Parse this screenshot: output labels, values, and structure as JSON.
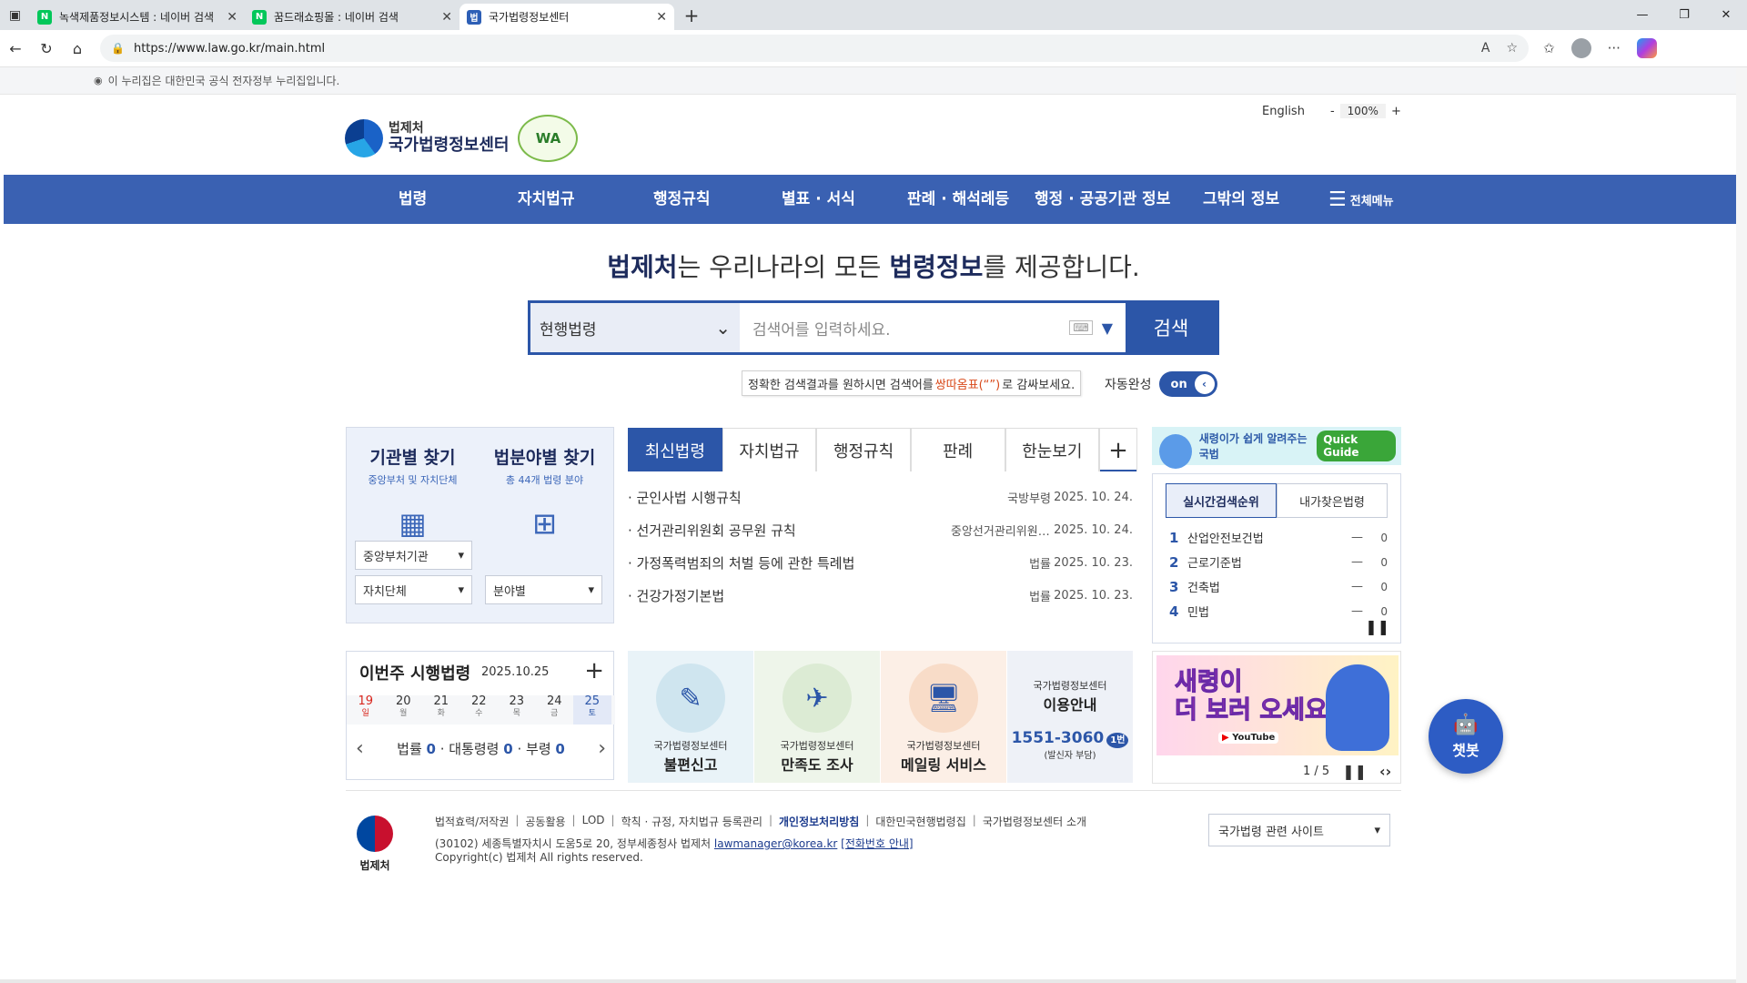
{
  "browser": {
    "tabs": [
      {
        "title": "녹색제품정보시스템 : 네이버 검색",
        "favicon": "N"
      },
      {
        "title": "꿈드래쇼핑몰 : 네이버 검색",
        "favicon": "N"
      },
      {
        "title": "국가법령정보센터",
        "favicon": "법"
      }
    ],
    "url": "https://www.law.go.kr/main.html"
  },
  "govbar": {
    "text": "이 누리집은 대한민국 공식 전자정부 누리집입니다."
  },
  "header": {
    "logo_small": "법제처",
    "logo_big": "국가법령정보센터",
    "wa_mark": "WA",
    "english": "English",
    "zoom_minus": "-",
    "zoom_value": "100%",
    "zoom_plus": "+"
  },
  "gnb": {
    "items": [
      "법령",
      "자치법규",
      "행정규칙",
      "별표 · 서식",
      "판례 · 해석례등",
      "행정 · 공공기관 정보",
      "그밖의 정보"
    ],
    "all_menu": "전체메뉴"
  },
  "slogan": {
    "b1": "법제처",
    "t1": "는 우리나라의 모든 ",
    "b2": "법령정보",
    "t2": "를 제공합니다."
  },
  "search": {
    "scope": "현행법령",
    "placeholder": "검색어를 입력하세요.",
    "button": "검색",
    "tip_pre": "정확한 검색결과를 원하시면 검색어를 ",
    "tip_em": "쌍따옴표(“”)",
    "tip_post": "로 감싸보세요.",
    "auto_label": "자동완성",
    "auto_state": "on"
  },
  "find": {
    "org_title": "기관별 찾기",
    "org_sub": "중앙부처 및 자치단체",
    "field_title": "법분야별 찾기",
    "field_sub": "총 44개 법령 분야",
    "sel_central": "중앙부처기관",
    "sel_local": "자치단체",
    "sel_field": "분야별"
  },
  "news": {
    "tabs": [
      "최신법령",
      "자치법규",
      "행정규칙",
      "판례",
      "한눈보기"
    ],
    "plus": "+",
    "rows": [
      {
        "title": "· 군인사법 시행규칙",
        "src": "국방부령",
        "date": "2025. 10. 24."
      },
      {
        "title": "· 선거관리위원회 공무원 규칙",
        "src": "중앙선거관리위원회규칙",
        "date": "2025. 10. 24."
      },
      {
        "title": "· 가정폭력범죄의 처벌 등에 관한 특례법",
        "src": "법률",
        "date": "2025. 10. 23."
      },
      {
        "title": "· 건강가정기본법",
        "src": "법률",
        "date": "2025. 10. 23."
      }
    ]
  },
  "quickguide": {
    "text": "새령이가 쉽게 알려주는 국법",
    "badge": "Quick Guide"
  },
  "rank": {
    "tab_realtime": "실시간검색순위",
    "tab_mine": "내가찾은법령",
    "rows": [
      {
        "n": "1",
        "t": "산업안전보건법",
        "v": "0"
      },
      {
        "n": "2",
        "t": "근로기준법",
        "v": "0"
      },
      {
        "n": "3",
        "t": "건축법",
        "v": "0"
      },
      {
        "n": "4",
        "t": "민법",
        "v": "0"
      }
    ]
  },
  "weekly": {
    "title": "이번주 시행법령",
    "date": "2025.10.25",
    "plus": "+",
    "days": [
      {
        "d": "19",
        "w": "일"
      },
      {
        "d": "20",
        "w": "월"
      },
      {
        "d": "21",
        "w": "화"
      },
      {
        "d": "22",
        "w": "수"
      },
      {
        "d": "23",
        "w": "목"
      },
      {
        "d": "24",
        "w": "금"
      },
      {
        "d": "25",
        "w": "토"
      }
    ],
    "law_label": "법률",
    "law_count": "0",
    "decree_label": "대통령령",
    "decree_count": "0",
    "ord_label": "부령",
    "ord_count": "0"
  },
  "banners": [
    {
      "sub": "국가법령정보센터",
      "title": "불편신고"
    },
    {
      "sub": "국가법령정보센터",
      "title": "만족도 조사"
    },
    {
      "sub": "국가법령정보센터",
      "title": "메일링 서비스"
    }
  ],
  "guide_banner": {
    "sub": "국가법령정보센터",
    "title": "이용안내",
    "phone": "1551-3060",
    "ext": "1번",
    "note": "(발신자 부담)"
  },
  "promo": {
    "line1": "새령이",
    "line2": "더 보러 오세요!",
    "yt": "YouTube",
    "page": "1 / 5"
  },
  "chatbot": {
    "label": "챗봇"
  },
  "footer": {
    "logo": "법제처",
    "links": [
      "법적효력/저작권",
      "공동활용",
      "LOD",
      "학칙 · 규정, 자치법규 등록관리",
      "개인정보처리방침",
      "대한민국현행법령집",
      "국가법령정보센터 소개"
    ],
    "addr": "(30102) 세종특별자치시 도움5로 20, 정부세종청사 법제처",
    "email": "lawmanager@korea.kr",
    "phone_info": "[전화번호 안내]",
    "copyright": "Copyright(c) 법제처 All rights reserved.",
    "related": "국가법령 관련 사이트"
  },
  "colors": {
    "primary": "#3a61b2",
    "navy": "#1d2b5c",
    "accent": "#2c56a8"
  }
}
